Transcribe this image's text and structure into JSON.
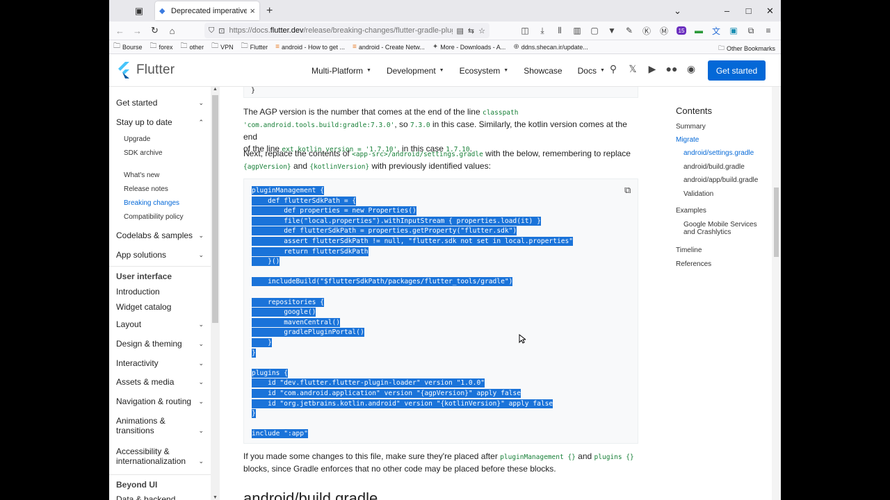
{
  "browser": {
    "tab_title": "Deprecated imperative apply of...",
    "url_prefix": "https://docs.",
    "url_domain": "flutter.dev",
    "url_path": "/release/breaking-changes/flutter-gradle-plugin",
    "bookmarks": [
      "Bourse",
      "forex",
      "other",
      "VPN",
      "Flutter",
      "android - How to get ...",
      "android - Create Netw...",
      "More - Downloads - A...",
      "ddns.shecan.ir/update..."
    ],
    "other_bookmarks": "Other Bookmarks",
    "extension_badge": "15"
  },
  "site": {
    "logo_text": "Flutter",
    "nav": [
      {
        "label": "Multi-Platform",
        "dropdown": true
      },
      {
        "label": "Development",
        "dropdown": true
      },
      {
        "label": "Ecosystem",
        "dropdown": true
      },
      {
        "label": "Showcase",
        "dropdown": false
      },
      {
        "label": "Docs",
        "dropdown": true
      }
    ],
    "cta": "Get started"
  },
  "sidebar": {
    "items": {
      "get_started": "Get started",
      "stay_up_to_date": "Stay up to date",
      "upgrade": "Upgrade",
      "sdk_archive": "SDK archive",
      "whats_new": "What's new",
      "release_notes": "Release notes",
      "breaking_changes": "Breaking changes",
      "compat_policy": "Compatibility policy",
      "codelabs": "Codelabs & samples",
      "app_solutions": "App solutions",
      "user_interface": "User interface",
      "introduction": "Introduction",
      "widget_catalog": "Widget catalog",
      "layout": "Layout",
      "design_theming": "Design & theming",
      "interactivity": "Interactivity",
      "assets_media": "Assets & media",
      "navigation_routing": "Navigation & routing",
      "animations_1": "Animations &",
      "animations_2": "transitions",
      "accessibility_1": "Accessibility &",
      "accessibility_2": "internationalization",
      "beyond_ui": "Beyond UI",
      "data_backend": "Data & backend"
    }
  },
  "content": {
    "code_top_line": "}",
    "p1_a": "The AGP version is the number that comes at the end of the line ",
    "p1_code1": "classpath",
    "p1_code2": "'com.android.tools.build:gradle:7.3.0'",
    "p1_b": ", so ",
    "p1_code3": "7.3.0",
    "p1_c": " in this case. Similarly, the kotlin version comes at the end",
    "p1_d": "of the line ",
    "p1_code4": "ext.kotlin_version = '1.7.10'",
    "p1_e": ", in this case ",
    "p1_code5": "1.7.10",
    "p1_f": ".",
    "p2_a": "Next, replace the contents of ",
    "p2_code1": "<app-src>/android/settings.gradle",
    "p2_b": " with the below, remembering to replace",
    "p2_code2": "{agpVersion}",
    "p2_c": " and ",
    "p2_code3": "{kotlinVersion}",
    "p2_d": " with previously identified values:",
    "code_lines": [
      "pluginManagement {",
      "    def flutterSdkPath = {",
      "        def properties = new Properties()",
      "        file(\"local.properties\").withInputStream { properties.load(it) }",
      "        def flutterSdkPath = properties.getProperty(\"flutter.sdk\")",
      "        assert flutterSdkPath != null, \"flutter.sdk not set in local.properties\"",
      "        return flutterSdkPath",
      "    }()",
      "",
      "    includeBuild(\"$flutterSdkPath/packages/flutter_tools/gradle\")",
      "",
      "    repositories {",
      "        google()",
      "        mavenCentral()",
      "        gradlePluginPortal()",
      "    }",
      "}",
      "",
      "plugins {",
      "    id \"dev.flutter.flutter-plugin-loader\" version \"1.0.0\"",
      "    id \"com.android.application\" version \"{agpVersion}\" apply false",
      "    id \"org.jetbrains.kotlin.android\" version \"{kotlinVersion}\" apply false",
      "}",
      "",
      "include \":app\""
    ],
    "p3_a": "If you made some changes to this file, make sure they're placed after ",
    "p3_code1": "pluginManagement {}",
    "p3_b": " and ",
    "p3_code2": "plugins {}",
    "p3_c": "blocks, since Gradle enforces that no other code may be placed before these blocks.",
    "next_heading": "android/build.gradle"
  },
  "toc": {
    "title": "Contents",
    "items": {
      "summary": "Summary",
      "migrate": "Migrate",
      "settings_gradle": "android/settings.gradle",
      "build_gradle": "android/build.gradle",
      "app_build_gradle": "android/app/build.gradle",
      "validation": "Validation",
      "examples": "Examples",
      "gms_1": "Google Mobile Services",
      "gms_2": "and Crashlytics",
      "timeline": "Timeline",
      "references": "References"
    }
  },
  "colors": {
    "accent": "#0468d7",
    "selection": "#1a73d9",
    "code_green": "#188038"
  }
}
